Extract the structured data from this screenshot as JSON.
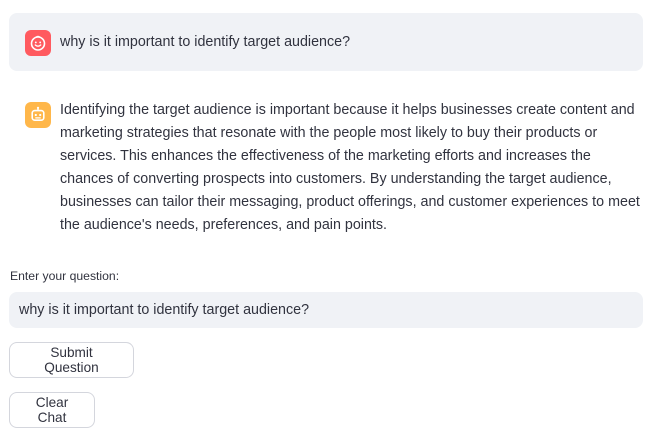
{
  "chat": {
    "user_message": "why is it important to identify target audience?",
    "assistant_message": "Identifying the target audience is important because it helps businesses create content and marketing strategies that resonate with the people most likely to buy their products or services. This enhances the effectiveness of the marketing efforts and increases the chances of converting prospects into customers. By understanding the target audience, businesses can tailor their messaging, product offerings, and customer experiences to meet the audience's needs, preferences, and pain points.",
    "user_avatar_icon": "smiley-face-icon",
    "assistant_avatar_icon": "robot-icon"
  },
  "form": {
    "label": "Enter your question:",
    "input_value": "why is it important to identify target audience?",
    "submit_label": "Submit Question",
    "clear_label": "Clear Chat"
  },
  "colors": {
    "user_avatar": "#ff5a5f",
    "assistant_avatar": "#ffb74a",
    "bubble_bg": "#f0f2f6",
    "text": "#31333f"
  }
}
